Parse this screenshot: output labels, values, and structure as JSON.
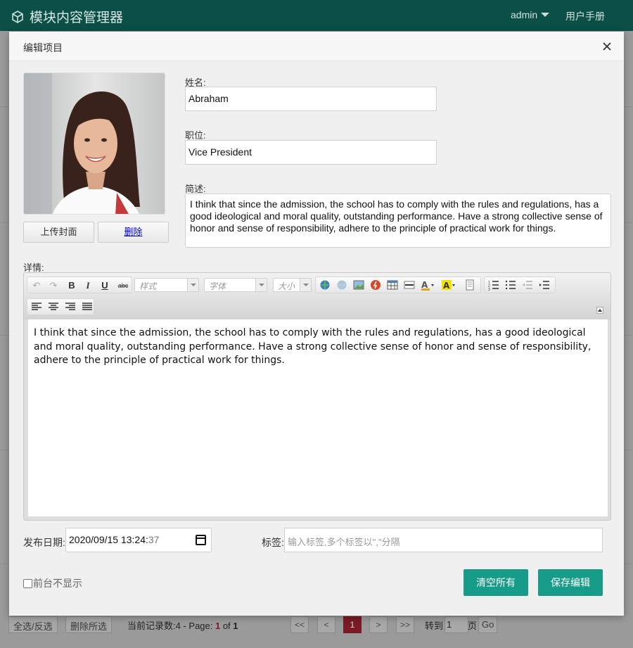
{
  "topbar": {
    "app_title": "模块内容管理器",
    "user": "admin",
    "manual": "用户手册"
  },
  "footer": {
    "select_all": "全选/反选",
    "delete_selected": "删除所选",
    "record_prefix": "当前记录数:4 - Page: ",
    "current_page": "1",
    "of_label": " of ",
    "total_pages": "1",
    "pager": {
      "first": "<<",
      "prev": "<",
      "page": "1",
      "next": ">",
      "last": ">>"
    },
    "goto_label": "转到",
    "goto_value": "1",
    "page_unit": "页",
    "go": "Go"
  },
  "modal": {
    "title": "编辑项目",
    "upload_label": "上传封面",
    "delete_label": "删除",
    "name": {
      "label": "姓名:",
      "value": "Abraham"
    },
    "position": {
      "label": "职位:",
      "value": "Vice President"
    },
    "summary": {
      "label": "简述:",
      "value": "I think that since the admission, the school has to comply with the rules and regulations, has a good ideological and moral quality, outstanding performance. Have a strong collective sense of honor and sense of responsibility, adhere to the principle of practical work for things."
    },
    "details": {
      "label": "详情:",
      "toolbar": {
        "style_placeholder": "样式",
        "font_placeholder": "字体",
        "size_placeholder": "大小"
      },
      "content": "I think that since the admission, the school has to comply with the rules and regulations, has a good ideological and moral quality, outstanding performance. Have a strong collective sense of honor and sense of responsibility, adhere to the principle of practical work for things."
    },
    "publish_date": {
      "label": "发布日期:",
      "value": "2020/09/15  13:24:",
      "seconds": "37"
    },
    "tags": {
      "label": "标签:",
      "placeholder": "输入标签,多个标签以\",\"分隔"
    },
    "hide_frontend": "前台不显示",
    "clear_all": "清空所有",
    "save": "保存编辑"
  },
  "colors": {
    "topbar": "#0b4f46",
    "primary": "#179c8a",
    "active_page": "#7a1a24"
  }
}
